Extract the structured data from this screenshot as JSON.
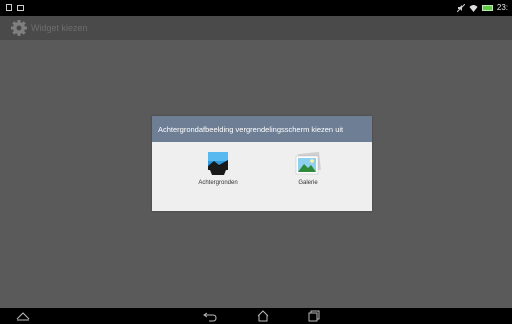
{
  "status_bar": {
    "time": "23:"
  },
  "action_bar": {
    "title": "Widget kiezen"
  },
  "dialog": {
    "title": "Achtergrondafbeelding vergrendelingsscherm kiezen uit",
    "options": [
      {
        "label": "Achtergronden",
        "icon": "wallpaper-icon"
      },
      {
        "label": "Galerie",
        "icon": "gallery-icon"
      }
    ]
  },
  "nav_bar": {
    "icons": [
      "up-icon",
      "back-icon",
      "home-icon",
      "recents-icon"
    ]
  }
}
